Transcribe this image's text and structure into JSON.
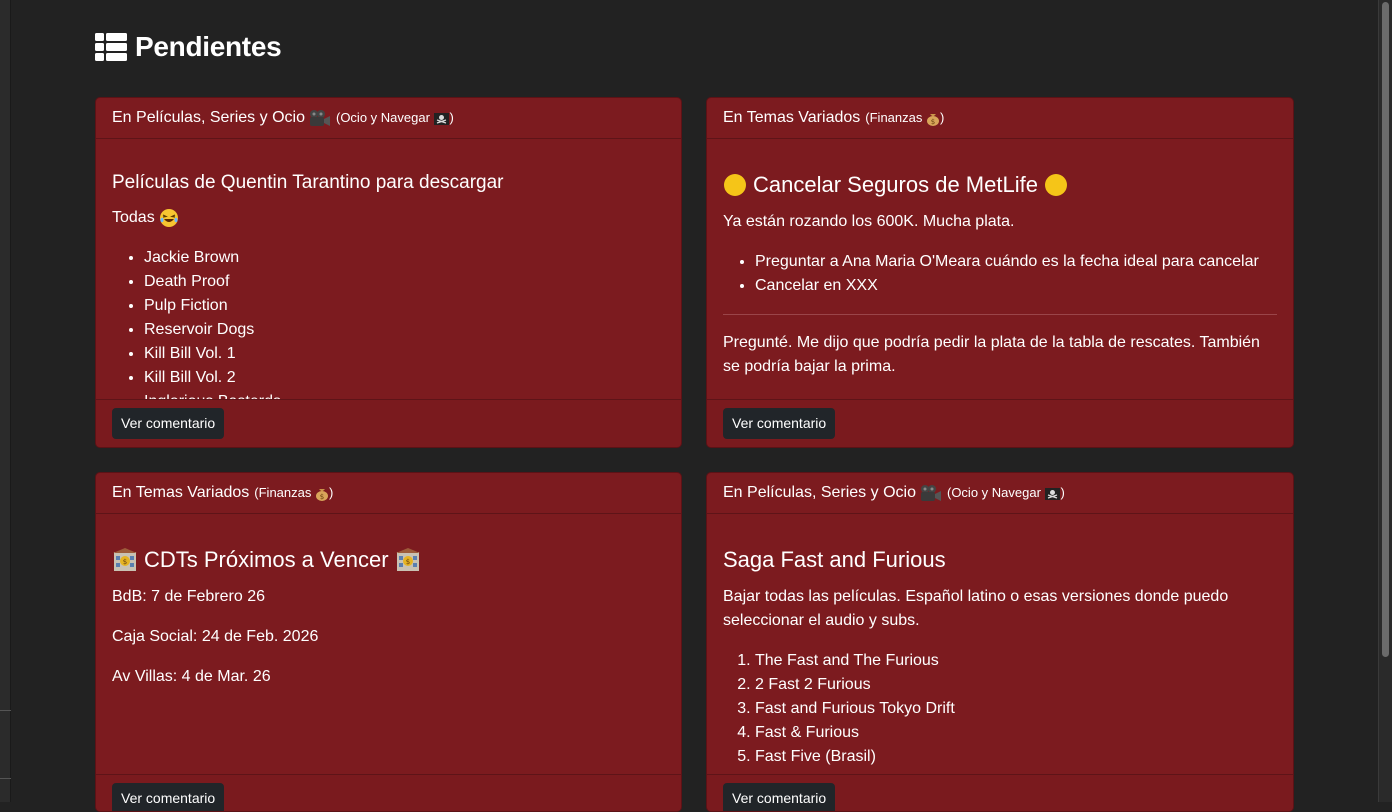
{
  "page": {
    "title": "Pendientes",
    "title_icon": "list-icon"
  },
  "cards": [
    {
      "header": {
        "category": "En Películas, Series y Ocio",
        "category_icon": "film-camera-icon",
        "sub": "Ocio y Navegar",
        "sub_icon": "pirate-flag-icon"
      },
      "title": "Películas de Quentin Tarantino para descargar",
      "intro": "Todas",
      "intro_icon": "laughing-face-icon",
      "list": [
        "Jackie Brown",
        "Death Proof",
        "Pulp Fiction",
        "Reservoir Dogs",
        "Kill Bill Vol. 1",
        "Kill Bill Vol. 2",
        "Inglorious Basterds"
      ],
      "button": "Ver comentario"
    },
    {
      "header": {
        "category": "En Temas Variados",
        "sub": "Finanzas",
        "sub_icon": "money-bag-icon"
      },
      "title": "Cancelar Seguros de MetLife",
      "title_icon": "yellow-circle-icon",
      "intro": "Ya están rozando los 600K. Mucha plata.",
      "list": [
        "Preguntar a Ana Maria O'Meara cuándo es la fecha ideal para cancelar",
        "Cancelar en XXX"
      ],
      "comment": "Pregunté. Me dijo que podría pedir la plata de la tabla de rescates. También se podría bajar la prima.",
      "button": "Ver comentario"
    },
    {
      "header": {
        "category": "En Temas Variados",
        "sub": "Finanzas",
        "sub_icon": "money-bag-icon"
      },
      "title": "CDTs Próximos a Vencer",
      "title_icon": "bank-icon",
      "lines": [
        "BdB: 7 de Febrero 26",
        "Caja Social: 24 de Feb. 2026",
        "Av Villas: 4 de Mar. 26"
      ],
      "button": "Ver comentario"
    },
    {
      "header": {
        "category": "En Películas, Series y Ocio",
        "category_icon": "film-camera-icon",
        "sub": "Ocio y Navegar",
        "sub_icon": "pirate-flag-icon"
      },
      "title": "Saga Fast and Furious",
      "intro": "Bajar todas las películas. Español latino o esas versiones donde puedo seleccionar el audio y subs.",
      "numbered": [
        "The Fast and The Furious",
        "2 Fast 2 Furious",
        "Fast and Furious Tokyo Drift",
        "Fast & Furious",
        "Fast Five (Brasil)"
      ],
      "button": "Ver comentario"
    }
  ]
}
